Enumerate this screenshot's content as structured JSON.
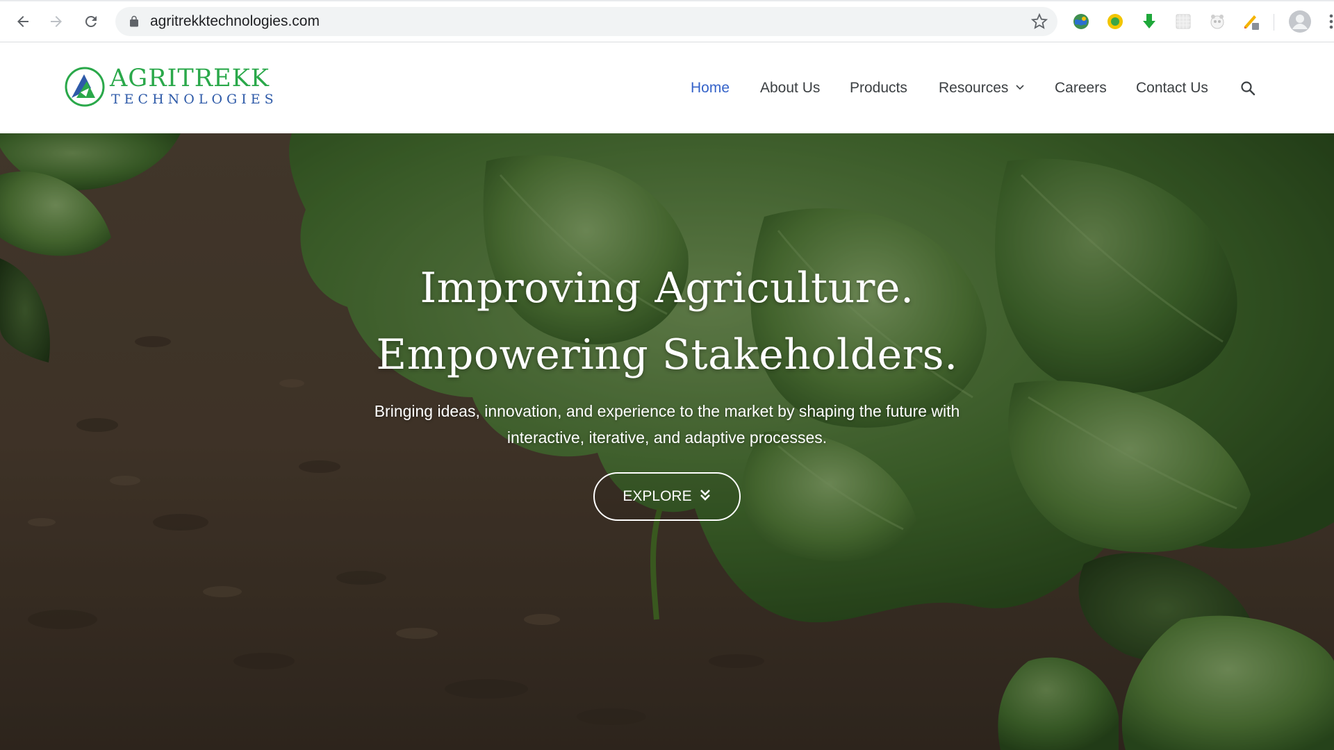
{
  "browser": {
    "url": "agritrekktechnologies.com",
    "icons": [
      "back-icon",
      "forward-icon",
      "reload-icon",
      "lock-icon",
      "bookmark-star-icon",
      "profile-icon",
      "menu-kebab-icon"
    ],
    "extensions": [
      "globe-extension-icon",
      "yellow-coin-extension-icon",
      "download-arrow-extension-icon",
      "grid-extension-icon",
      "panda-extension-icon",
      "pencil-extension-icon"
    ]
  },
  "site": {
    "logo": {
      "name": "AGRITREKK",
      "sub": "TECHNOLOGIES"
    },
    "nav": {
      "home": "Home",
      "about": "About Us",
      "products": "Products",
      "resources": "Resources",
      "careers": "Careers",
      "contact": "Contact Us"
    }
  },
  "hero": {
    "title_line1": "Improving Agriculture.",
    "title_line2": "Empowering Stakeholders.",
    "subtitle_line1": "Bringing ideas, innovation, and experience to the market by shaping the future with",
    "subtitle_line2": "interactive, iterative, and adaptive processes.",
    "button_label": "EXPLORE"
  },
  "colors": {
    "accent_blue": "#3563c9",
    "logo_green": "#2aa84a",
    "logo_blue": "#2e5aa8"
  }
}
